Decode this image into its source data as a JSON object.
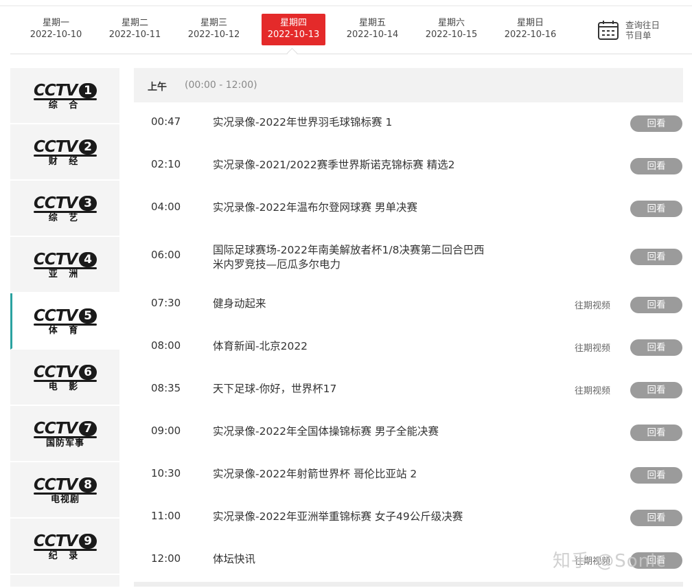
{
  "days": [
    {
      "weekday": "星期一",
      "date": "2022-10-10",
      "active": false
    },
    {
      "weekday": "星期二",
      "date": "2022-10-11",
      "active": false
    },
    {
      "weekday": "星期三",
      "date": "2022-10-12",
      "active": false
    },
    {
      "weekday": "星期四",
      "date": "2022-10-13",
      "active": true
    },
    {
      "weekday": "星期五",
      "date": "2022-10-14",
      "active": false
    },
    {
      "weekday": "星期六",
      "date": "2022-10-15",
      "active": false
    },
    {
      "weekday": "星期日",
      "date": "2022-10-16",
      "active": false
    }
  ],
  "calendar": {
    "line1": "查询往日",
    "line2": "节目单",
    "icon": "calendar-icon"
  },
  "channels": [
    {
      "brand": "CCTV",
      "number": "1",
      "name": "综 合",
      "active": false
    },
    {
      "brand": "CCTV",
      "number": "2",
      "name": "财 经",
      "active": false
    },
    {
      "brand": "CCTV",
      "number": "3",
      "name": "综 艺",
      "active": false
    },
    {
      "brand": "CCTV",
      "number": "4",
      "name": "亚 洲",
      "active": false
    },
    {
      "brand": "CCTV",
      "number": "5",
      "name": "体 育",
      "active": true
    },
    {
      "brand": "CCTV",
      "number": "6",
      "name": "电 影",
      "active": false
    },
    {
      "brand": "CCTV",
      "number": "7",
      "name": "国防军事",
      "active": false
    },
    {
      "brand": "CCTV",
      "number": "8",
      "name": "电视剧",
      "active": false
    },
    {
      "brand": "CCTV",
      "number": "9",
      "name": "纪 录",
      "active": false
    }
  ],
  "schedule": {
    "period": "上午",
    "range": "(00:00 - 12:00)",
    "programs": [
      {
        "time": "00:47",
        "title": "实况录像-2022年世界羽毛球锦标赛 1",
        "past": "",
        "replay": "回看"
      },
      {
        "time": "02:10",
        "title": "实况录像-2021/2022赛季世界斯诺克锦标赛 精选2",
        "past": "",
        "replay": "回看"
      },
      {
        "time": "04:00",
        "title": "实况录像-2022年温布尔登网球赛 男单决赛",
        "past": "",
        "replay": "回看"
      },
      {
        "time": "06:00",
        "title": "国际足球赛场-2022年南美解放者杯1/8决赛第二回合巴西米内罗竞技—厄瓜多尔电力",
        "past": "",
        "replay": "回看"
      },
      {
        "time": "07:30",
        "title": "健身动起来",
        "past": "往期视频",
        "replay": "回看"
      },
      {
        "time": "08:00",
        "title": "体育新闻-北京2022",
        "past": "往期视频",
        "replay": "回看"
      },
      {
        "time": "08:35",
        "title": "天下足球-你好，世界杯17",
        "past": "往期视频",
        "replay": "回看"
      },
      {
        "time": "09:00",
        "title": "实况录像-2022年全国体操锦标赛 男子全能决赛",
        "past": "",
        "replay": "回看"
      },
      {
        "time": "10:30",
        "title": "实况录像-2022年射箭世界杯 哥伦比亚站 2",
        "past": "",
        "replay": "回看"
      },
      {
        "time": "11:00",
        "title": "实况录像-2022年亚洲举重锦标赛 女子49公斤级决赛",
        "past": "",
        "replay": "回看"
      },
      {
        "time": "12:00",
        "title": "体坛快讯",
        "past": "往期视频",
        "replay": "回看"
      }
    ]
  },
  "watermark": "知乎 @Sonic",
  "colors": {
    "active_day": "#e42a2a",
    "active_channel_border": "#2aa2a0",
    "replay_button": "#9b9b9b"
  }
}
